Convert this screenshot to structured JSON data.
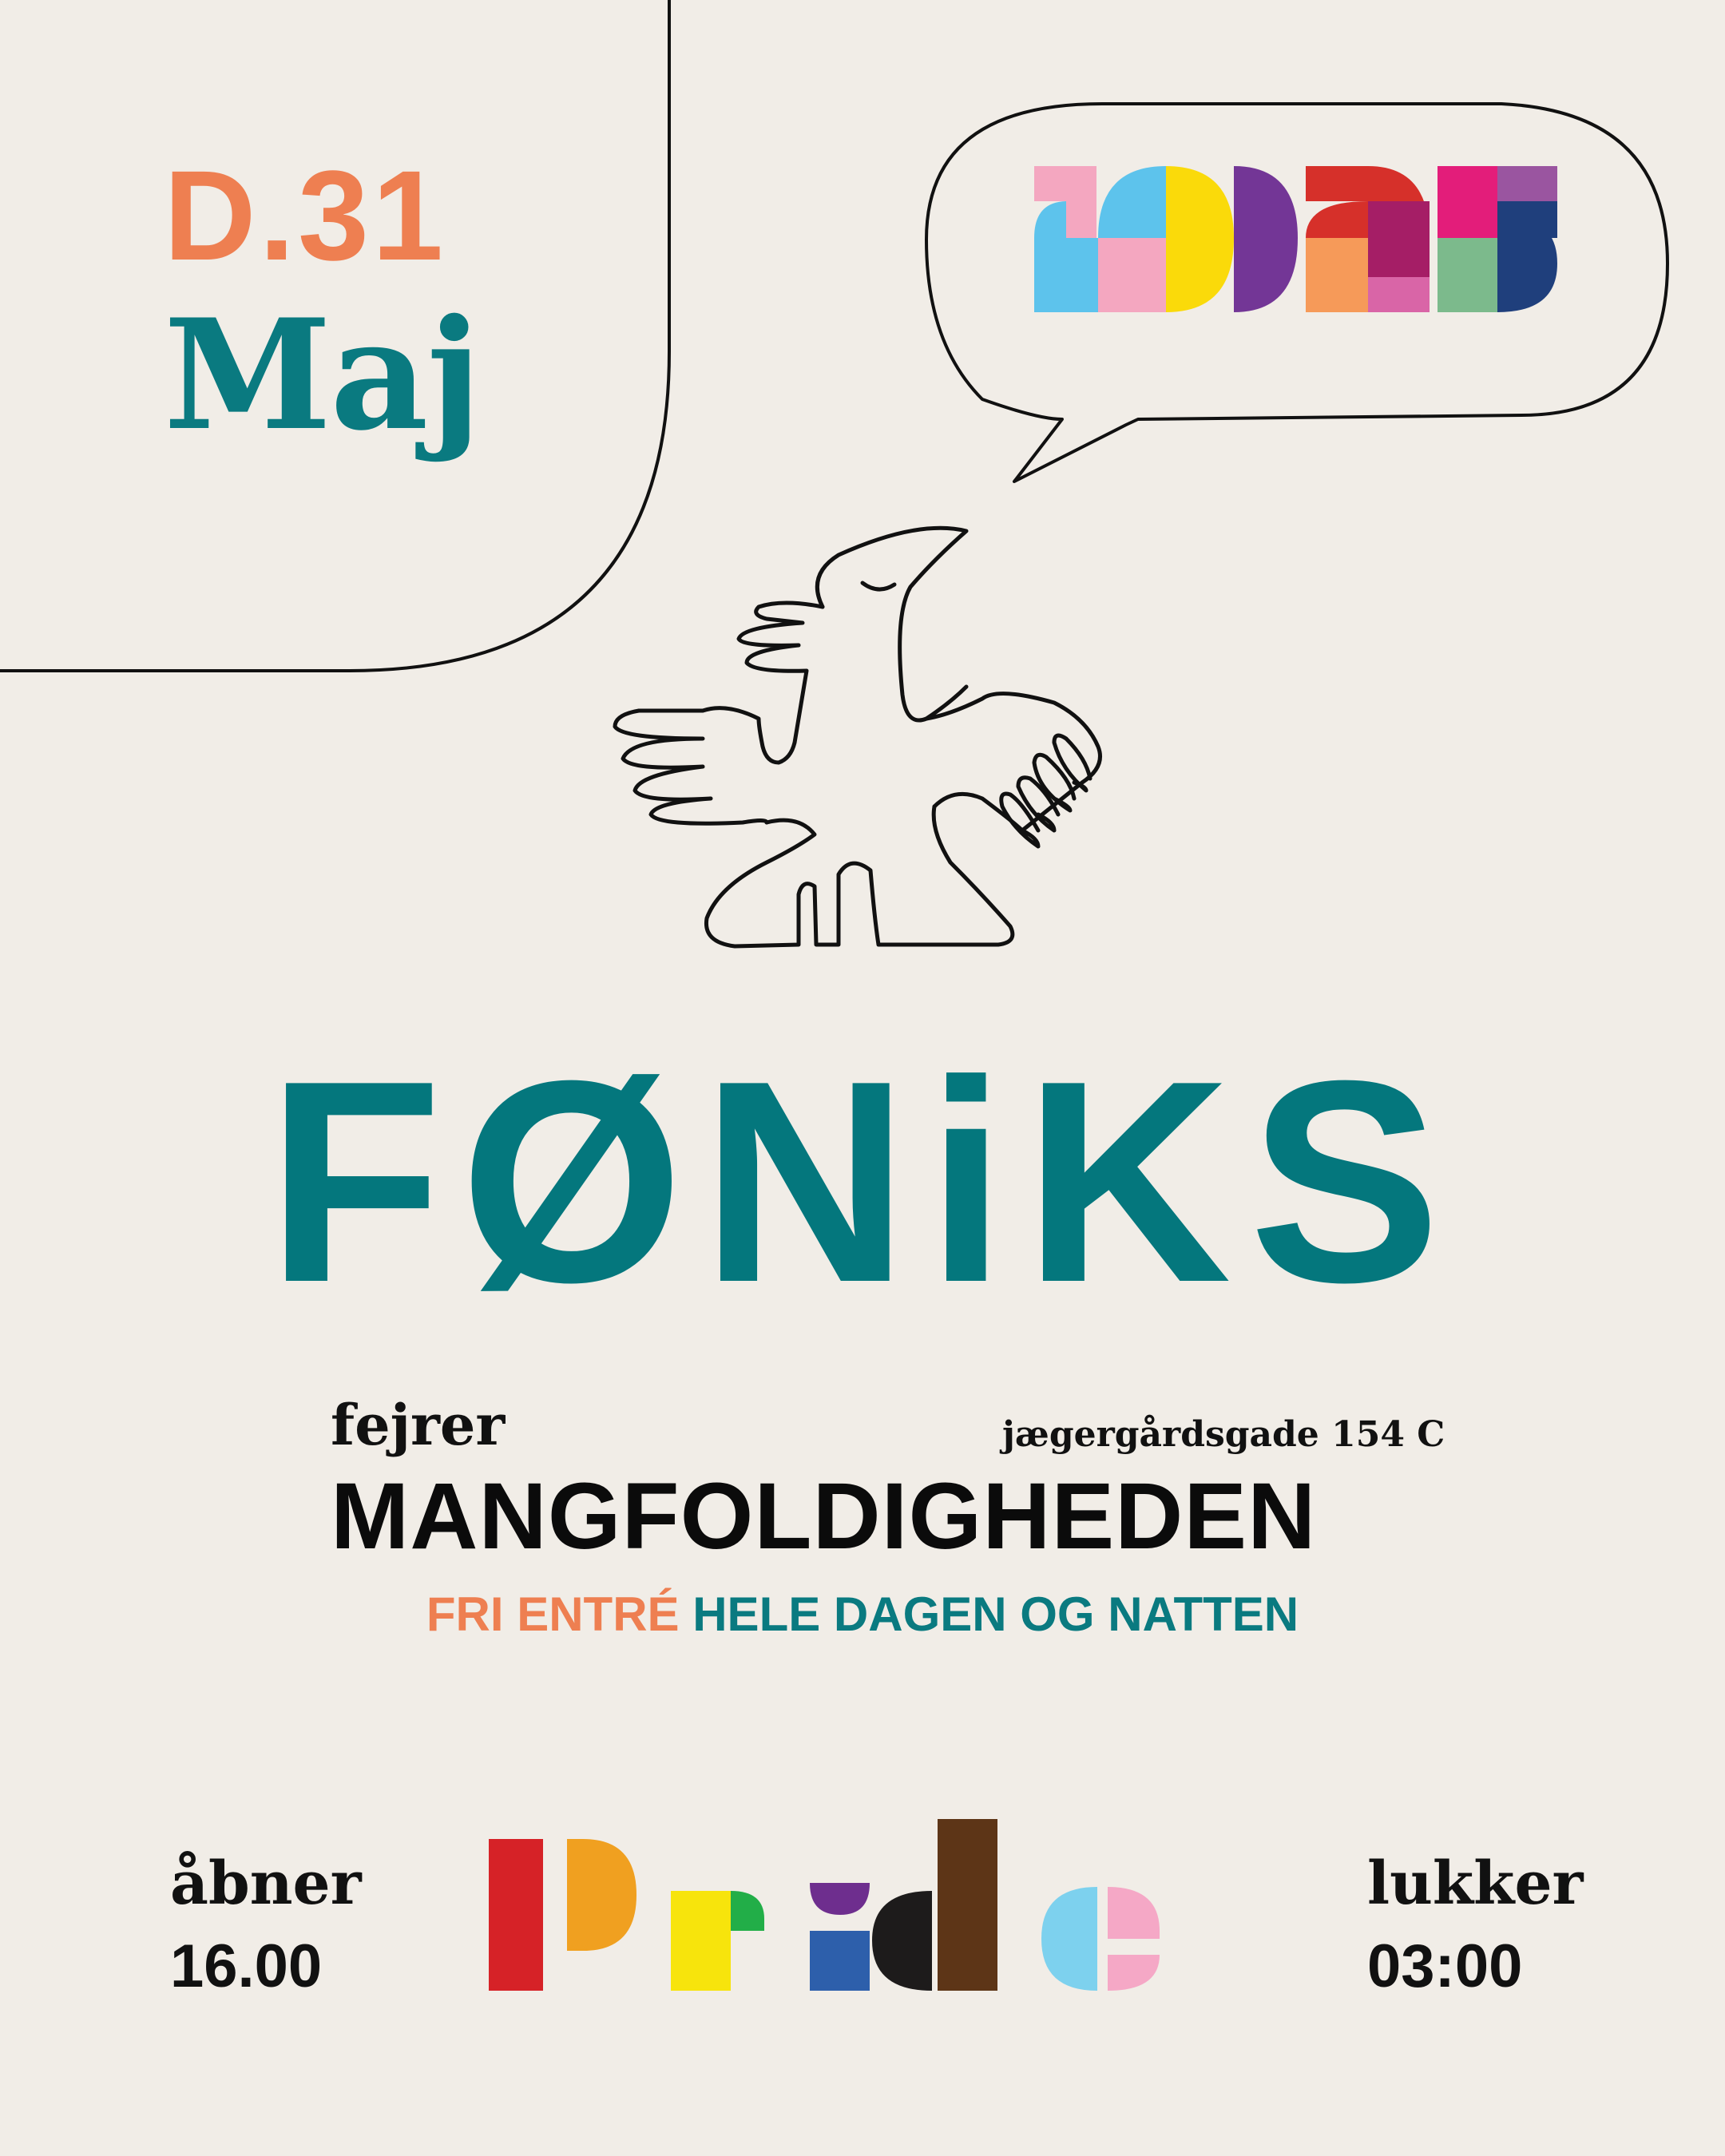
{
  "date": {
    "day": "D.31",
    "month": "Maj"
  },
  "year_badge": "2025",
  "brand": {
    "name": "FØNiKS"
  },
  "tagline": {
    "verb": "fejrer",
    "main": "MANGFOLDIGHEDEN"
  },
  "address": "jægergårdsgade 154 C",
  "entry": {
    "free": "FRI ENTRÉ",
    "hours": "HELE DAGEN OG NATTEN"
  },
  "event_word": "Pride",
  "hours": {
    "open_label": "åbner",
    "open_time": "16.00",
    "close_label": "lukker",
    "close_time": "03:00"
  },
  "colors": {
    "background": "#f1ede7",
    "teal": "#04777d",
    "orange": "#ee7f51",
    "ink": "#111111"
  },
  "icons": [
    "phoenix-bird-icon",
    "speech-bubble-icon"
  ]
}
